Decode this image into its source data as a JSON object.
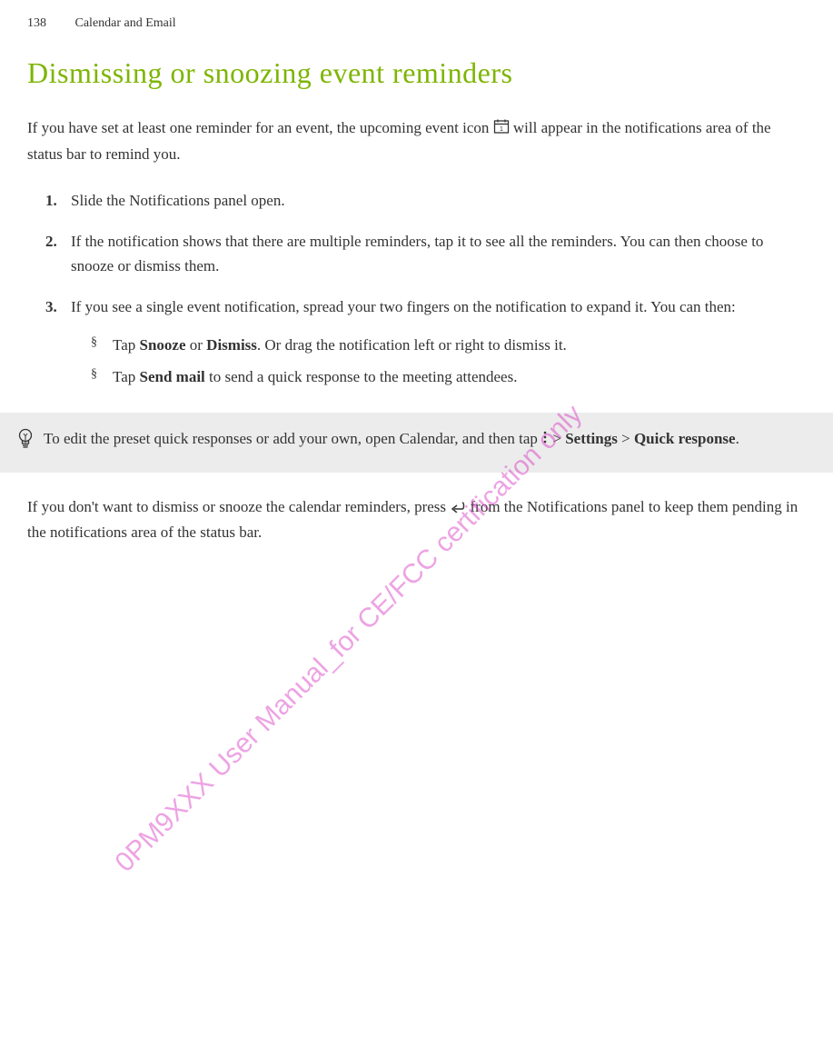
{
  "header": {
    "page_number": "138",
    "chapter": "Calendar and Email"
  },
  "main_heading": "Dismissing or snoozing event reminders",
  "intro": {
    "part1": "If you have set at least one reminder for an event, the upcoming event icon ",
    "part2": " will appear in the notifications area of the status bar to remind you."
  },
  "steps": [
    {
      "num": "1.",
      "text": "Slide the Notifications panel open."
    },
    {
      "num": "2.",
      "text": "If the notification shows that there are multiple reminders, tap it to see all the reminders. You can then choose to snooze or dismiss them."
    },
    {
      "num": "3.",
      "text": "If you see a single event notification, spread your two fingers on the notification to expand it. You can then:"
    }
  ],
  "bullets": [
    {
      "pre": "Tap ",
      "bold1": "Snooze",
      "mid": " or ",
      "bold2": "Dismiss",
      "post": ". Or drag the notification left or right to dismiss it."
    },
    {
      "pre": "Tap ",
      "bold1": "Send mail",
      "post": " to send a quick response to the meeting attendees."
    }
  ],
  "tip": {
    "part1": "To edit the preset quick responses or add your own, open Calendar, and then tap ",
    "gt1": " > ",
    "bold1": "Settings",
    "gt2": " > ",
    "bold2": "Quick response",
    "period": "."
  },
  "after_tip": {
    "part1": "If you don't want to dismiss or snooze the calendar reminders, press ",
    "part2": " from the Notifications panel to keep them pending in the notifications area of the status bar."
  },
  "watermark": "0PM9XXX User Manual_for CE/FCC certification only",
  "icons": {
    "event_icon": "event-reminder-icon",
    "menu_icon": "overflow-menu-icon",
    "back_icon": "back-icon",
    "tip_icon": "lightbulb-icon"
  }
}
